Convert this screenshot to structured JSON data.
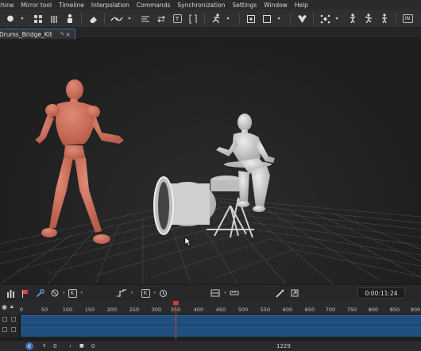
{
  "menu": [
    "chine",
    "Mirror tool",
    "Timeline",
    "Interpolation",
    "Commands",
    "Synchronization",
    "Settings",
    "Window",
    "Help"
  ],
  "toolbar": {
    "text_tool_label": "T",
    "in_label": "IN"
  },
  "document_tab": {
    "label": "Drums_Bridge_Kit"
  },
  "timeline": {
    "keyframe_label": "K",
    "timecode": "0:00:11:24",
    "ruler_labels": [
      "0",
      "50",
      "100",
      "150",
      "200",
      "250",
      "300",
      "350",
      "400",
      "450",
      "500",
      "550",
      "600",
      "650",
      "700",
      "750",
      "800",
      "850",
      "900"
    ]
  },
  "statusbar": {
    "k_label": "K",
    "field_a": "0",
    "field_b": "0",
    "frame": "1229"
  },
  "colors": {
    "accent": "#3e6fb3",
    "track": "#1f4f7e",
    "playhead": "#d23a3a",
    "mannequin_orange": "#d4735f",
    "mannequin_white": "#d6d6d6"
  }
}
